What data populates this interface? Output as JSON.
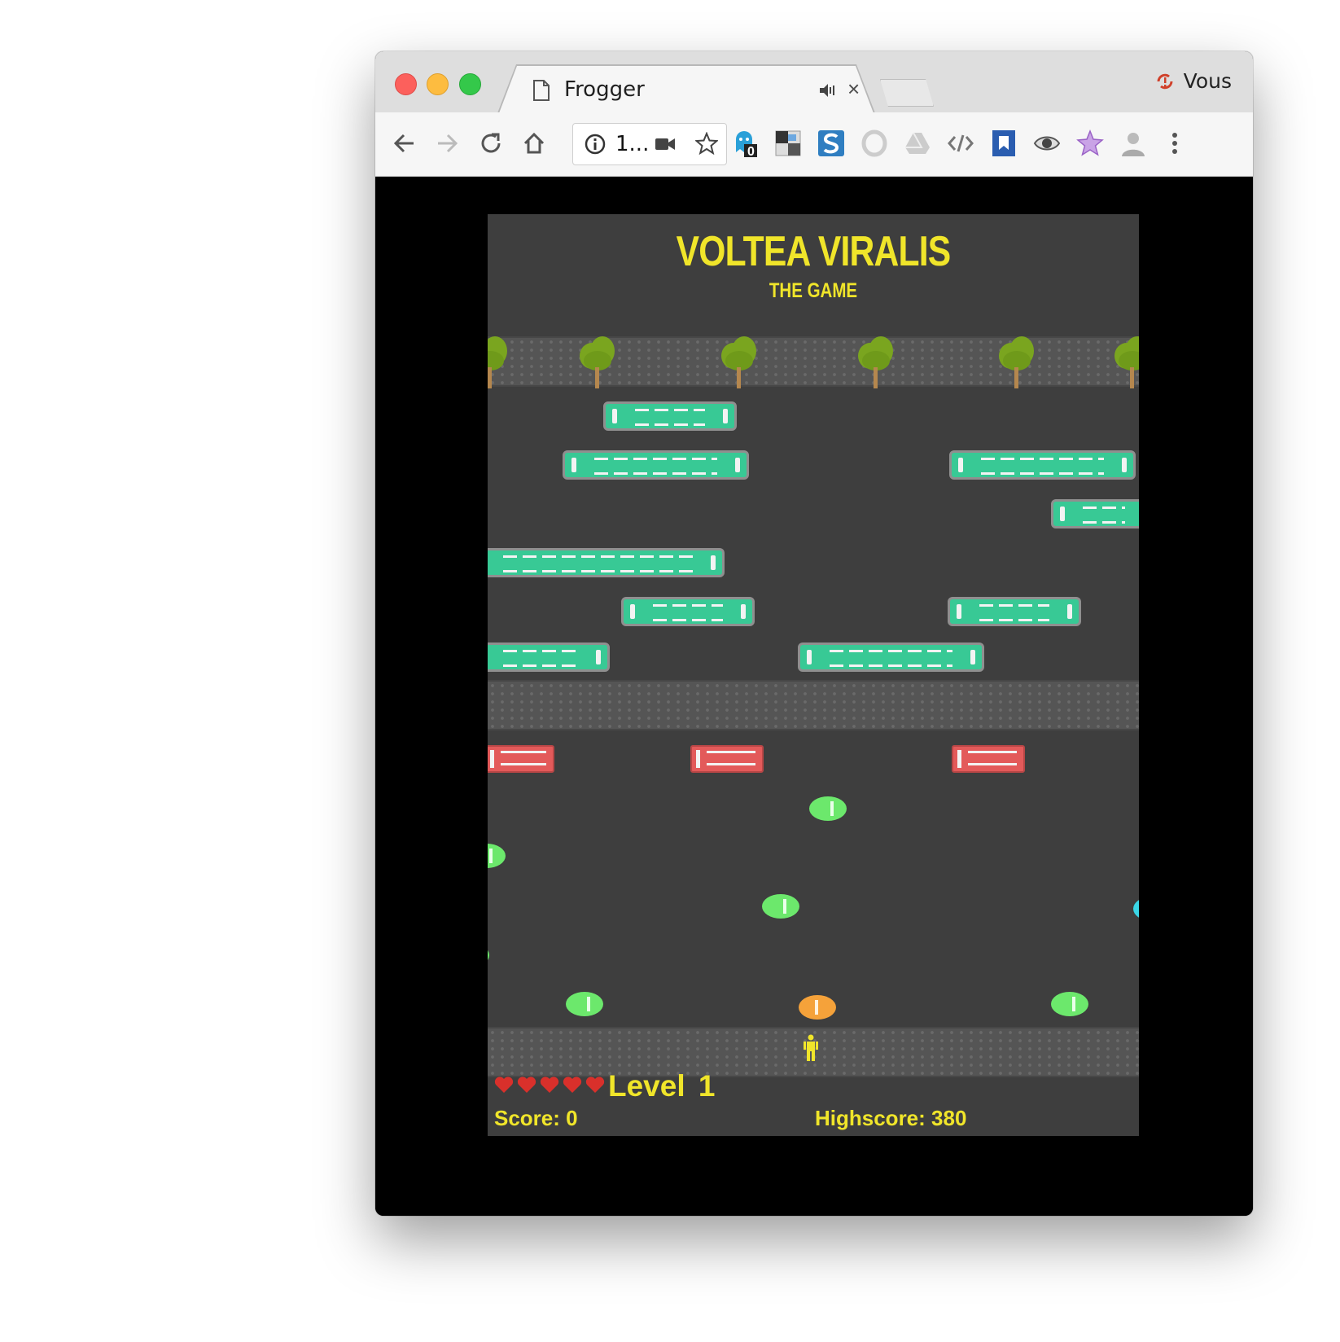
{
  "browser": {
    "tab_title": "Frogger",
    "address_text": "1...",
    "profile_name": "Vous",
    "extension_badge": "0"
  },
  "game": {
    "title": "VOLTEA VIRALIS",
    "subtitle": "THE GAME",
    "lives": 5,
    "level_label": "Level  1",
    "score_label": "Score: 0",
    "highscore_label": "Highscore: 380"
  },
  "colors": {
    "accent_yellow": "#f0e52a",
    "road": "#3e3e3e",
    "bus": "#38c995",
    "truck": "#e35a5a",
    "car": "#6ce86c",
    "car_orange": "#f5a23a",
    "tree": "#7aa51f"
  },
  "icons": [
    "page-icon",
    "audio-icon",
    "close-icon",
    "back-icon",
    "forward-icon",
    "reload-icon",
    "home-icon",
    "info-icon",
    "video-camera-icon",
    "star-icon",
    "menu-icon"
  ]
}
